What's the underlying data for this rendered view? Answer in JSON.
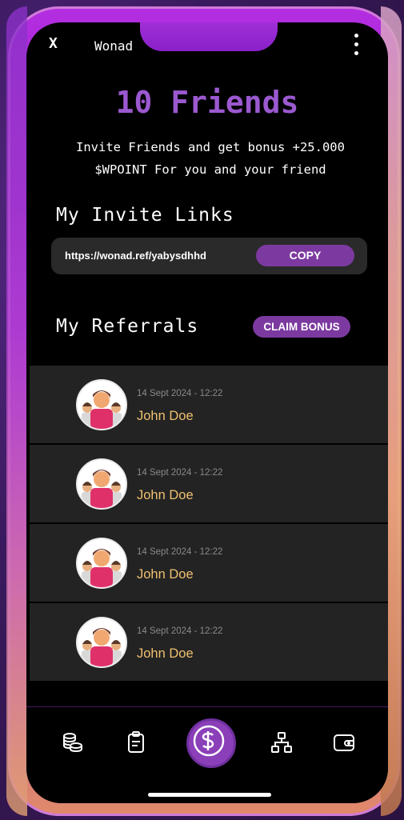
{
  "app": {
    "close_label": "X",
    "title": "Wonad"
  },
  "hero": {
    "headline": "10 Friends",
    "subtitle_line1": "Invite Friends and get bonus +25.000",
    "subtitle_line2": "$WPOINT For you and your friend"
  },
  "invite": {
    "section_title": "My Invite Links",
    "link": "https://wonad.ref/yabysdhhd",
    "copy_label": "COPY"
  },
  "referrals": {
    "section_title": "My Referrals",
    "claim_label": "CLAIM BONUS",
    "items": [
      {
        "date": "14 Sept 2024 - 12:22",
        "name": "John Doe"
      },
      {
        "date": "14 Sept 2024 - 12:22",
        "name": "John Doe"
      },
      {
        "date": "14 Sept 2024 - 12:22",
        "name": "John Doe"
      },
      {
        "date": "14 Sept 2024 - 12:22",
        "name": "John Doe"
      }
    ]
  },
  "bottom_nav": {
    "items": [
      {
        "icon": "coins-icon"
      },
      {
        "icon": "clipboard-icon"
      },
      {
        "icon": "dollar-icon"
      },
      {
        "icon": "network-icon"
      },
      {
        "icon": "wallet-icon"
      }
    ]
  },
  "colors": {
    "accent": "#9b59d0",
    "button": "#7c3aa0",
    "name": "#f0c070"
  }
}
